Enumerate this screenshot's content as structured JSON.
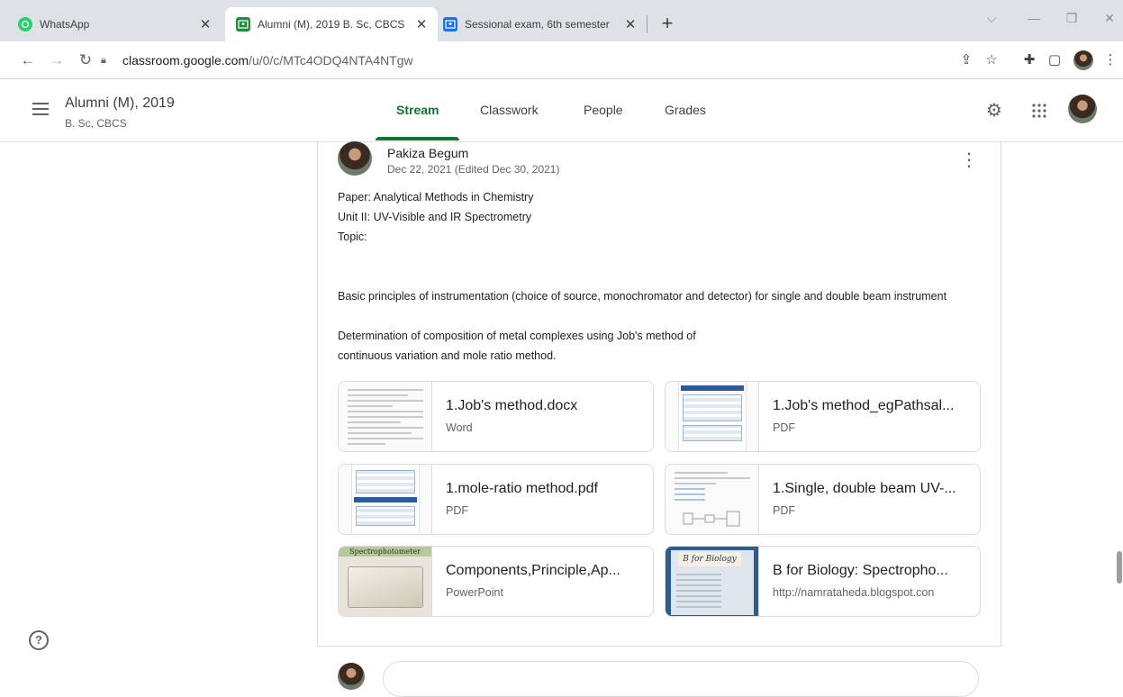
{
  "browser": {
    "tabs": [
      {
        "title": "WhatsApp",
        "icon": "whatsapp-icon",
        "color": "#25d366"
      },
      {
        "title": "Alumni (M), 2019 B. Sc, CBCS",
        "icon": "classroom-icon",
        "color": "#1e8e3e"
      },
      {
        "title": "Sessional exam, 6th semester",
        "icon": "classroom-icon",
        "color": "#1a73e8"
      }
    ],
    "url_host": "classroom.google.com",
    "url_path": "/u/0/c/MTc4ODQ4NTA4NTgw"
  },
  "header": {
    "class_name": "Alumni (M), 2019",
    "class_section": "B. Sc, CBCS",
    "nav": [
      {
        "label": "Stream",
        "active": true
      },
      {
        "label": "Classwork",
        "active": false
      },
      {
        "label": "People",
        "active": false
      },
      {
        "label": "Grades",
        "active": false
      }
    ]
  },
  "post": {
    "author": "Pakiza Begum",
    "date": "Dec 22, 2021 (Edited Dec 30, 2021)",
    "lines": [
      "Paper: Analytical Methods in Chemistry",
      "Unit II: UV-Visible and IR Spectrometry",
      "Topic:",
      "Basic principles of instrumentation (choice of source, monochromator and detector) for single and double beam instrument",
      "Determination of composition of metal complexes using Job's method of",
      "continuous variation and mole ratio method."
    ],
    "attachments": [
      {
        "name": "1.Job's method.docx",
        "kind": "Word",
        "thumb": "doc"
      },
      {
        "name": "1.Job's method_egPathsal...",
        "kind": "PDF",
        "thumb": "pdf"
      },
      {
        "name": "1.mole-ratio method.pdf",
        "kind": "PDF",
        "thumb": "pdf"
      },
      {
        "name": "1.Single, double beam UV-...",
        "kind": "PDF",
        "thumb": "doc"
      },
      {
        "name": "Components,Principle,Ap...",
        "kind": "PowerPoint",
        "thumb": "ppt",
        "thumb_title": "Spectrophotometer"
      },
      {
        "name": "B for Biology: Spectropho...",
        "kind": "http://namrataheda.blogspot.con",
        "thumb": "web",
        "thumb_title": "B for Biology"
      }
    ]
  },
  "colors": {
    "accent": "#137333",
    "tabstrip": "#dee1e6"
  }
}
